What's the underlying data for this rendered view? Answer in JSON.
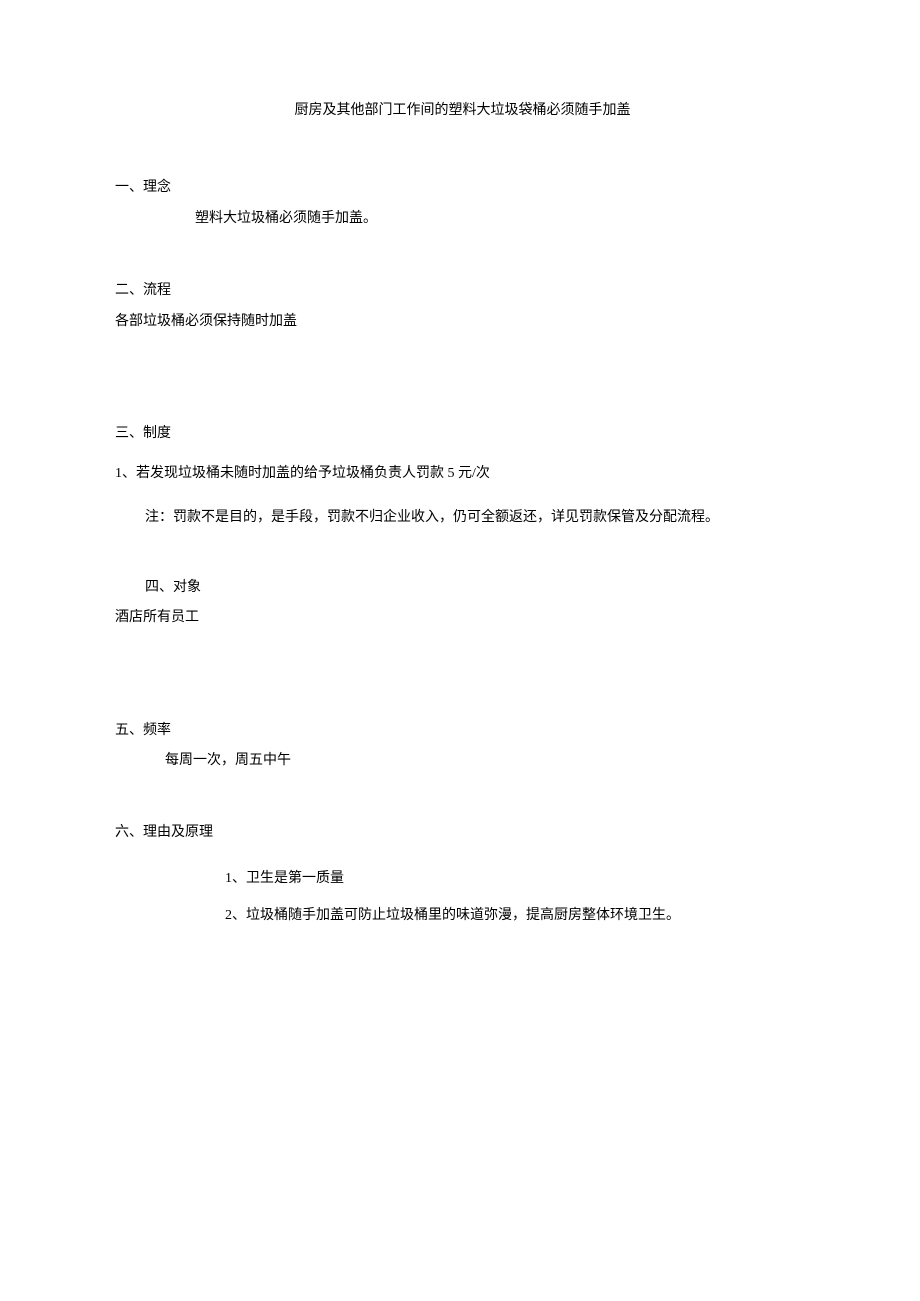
{
  "title": "厨房及其他部门工作间的塑料大垃圾袋桶必须随手加盖",
  "section1": {
    "heading": "一、理念",
    "content": "塑料大垃圾桶必须随手加盖。"
  },
  "section2": {
    "heading": "二、流程",
    "content": "各部垃圾桶必须保持随时加盖"
  },
  "section3": {
    "heading": "三、制度",
    "item1": "1、若发现垃圾桶未随时加盖的给予垃圾桶负责人罚款 5 元/次",
    "note": "注：罚款不是目的，是手段，罚款不归企业收入，仍可全额返还，详见罚款保管及分配流程。"
  },
  "section4": {
    "heading": "四、对象",
    "content": "酒店所有员工"
  },
  "section5": {
    "heading": "五、频率",
    "content": "每周一次，周五中午"
  },
  "section6": {
    "heading": "六、理由及原理",
    "item1": "1、卫生是第一质量",
    "item2": "2、垃圾桶随手加盖可防止垃圾桶里的味道弥漫，提高厨房整体环境卫生。"
  }
}
